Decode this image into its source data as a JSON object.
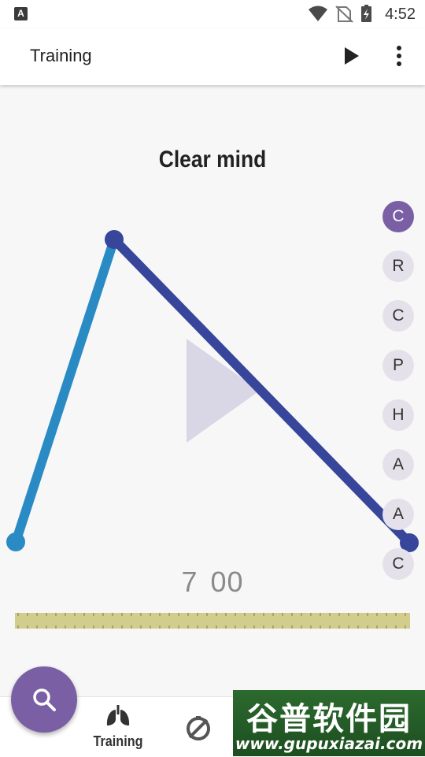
{
  "status_bar": {
    "notification_icon": "a-icon",
    "icons": [
      "wifi-icon",
      "no-sim-icon",
      "battery-charging-icon"
    ],
    "time": "4:52"
  },
  "app_bar": {
    "title": "Training",
    "actions": [
      "play-icon",
      "more-vert-icon"
    ]
  },
  "exercise": {
    "title": "Clear mind",
    "big_play_icon": "play-icon",
    "phases": [
      {
        "letter": "C",
        "active": true
      },
      {
        "letter": "R",
        "active": false
      },
      {
        "letter": "C",
        "active": false
      },
      {
        "letter": "P",
        "active": false
      },
      {
        "letter": "H",
        "active": false
      },
      {
        "letter": "A",
        "active": false
      },
      {
        "letter": "A",
        "active": false
      },
      {
        "letter": "C",
        "active": false
      }
    ],
    "timer": {
      "minutes": "7",
      "seconds": "00"
    },
    "progress": 0.0
  },
  "colors": {
    "accent": "#7a5fa4",
    "inhale_line": "#2a8bc4",
    "exhale_line": "#37469a",
    "progress_track": "#d2cd8c"
  },
  "fab": {
    "icon": "search-icon"
  },
  "bottom_nav": {
    "items": [
      {
        "icon": "lungs-icon",
        "label": "Training"
      },
      {
        "icon": "no-timer-icon",
        "label": ""
      }
    ]
  },
  "watermark": {
    "top_text": "谷普软件园",
    "bottom_text": "www.gupuxiazai.com"
  }
}
